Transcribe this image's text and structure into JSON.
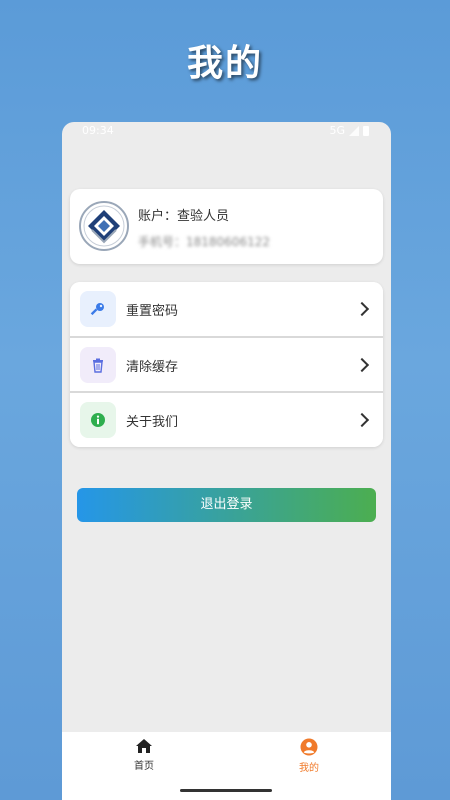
{
  "page_heading": "我的",
  "status_bar": {
    "time": "09:34",
    "network": "5G"
  },
  "profile": {
    "account": "账户：查验人员",
    "phone": "手机号：18180606122"
  },
  "menu": {
    "items": [
      {
        "label": "重置密码",
        "icon": "key-icon",
        "icon_bg": "#e8f0fd",
        "icon_color": "#3b7be8"
      },
      {
        "label": "清除缓存",
        "icon": "trash-icon",
        "icon_bg": "#f1ecfa",
        "icon_color": "#5b6ee0"
      },
      {
        "label": "关于我们",
        "icon": "info-icon",
        "icon_bg": "#e7f6ea",
        "icon_color": "#2eae4e"
      }
    ]
  },
  "logout_label": "退出登录",
  "tabbar": {
    "tabs": [
      {
        "label": "首页",
        "icon": "home-icon",
        "active": false
      },
      {
        "label": "我的",
        "icon": "user-icon",
        "active": true
      }
    ]
  },
  "colors": {
    "accent_tab": "#f07a2a",
    "button_start": "#2596e8",
    "button_end": "#4cae50"
  }
}
